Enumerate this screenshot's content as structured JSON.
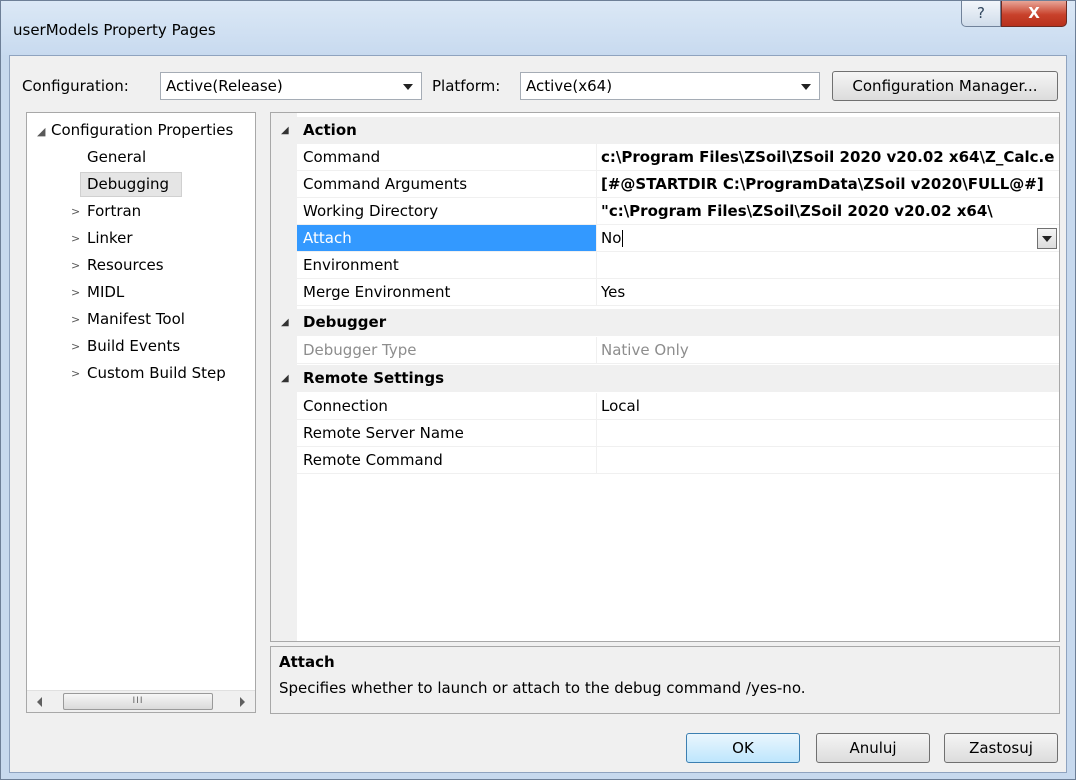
{
  "window": {
    "title": "userModels Property Pages",
    "help_glyph": "?",
    "close_glyph": "X"
  },
  "toolbar": {
    "configuration_label": "Configuration:",
    "configuration_value": "Active(Release)",
    "platform_label": "Platform:",
    "platform_value": "Active(x64)",
    "config_manager_label": "Configuration Manager..."
  },
  "tree": {
    "root": {
      "label": "Configuration Properties",
      "expander": "◢"
    },
    "items": [
      {
        "label": "General",
        "expander": ""
      },
      {
        "label": "Debugging",
        "expander": "",
        "selected": true
      },
      {
        "label": "Fortran",
        "expander": ">"
      },
      {
        "label": "Linker",
        "expander": ">"
      },
      {
        "label": "Resources",
        "expander": ">"
      },
      {
        "label": "MIDL",
        "expander": ">"
      },
      {
        "label": "Manifest Tool",
        "expander": ">"
      },
      {
        "label": "Build Events",
        "expander": ">"
      },
      {
        "label": "Custom Build Step",
        "expander": ">"
      }
    ],
    "scroll_thumb_grip": "III"
  },
  "grid": {
    "categories": [
      {
        "label": "Action",
        "expander": "◢",
        "rows": [
          {
            "name": "Command",
            "value": "c:\\Program Files\\ZSoil\\ZSoil 2020 v20.02 x64\\Z_Calc.e",
            "bold": true
          },
          {
            "name": "Command Arguments",
            "value": "[#@STARTDIR C:\\ProgramData\\ZSoil v2020\\FULL@#]",
            "bold": true
          },
          {
            "name": "Working Directory",
            "value": "\"c:\\Program Files\\ZSoil\\ZSoil 2020 v20.02 x64\\",
            "bold": true
          },
          {
            "name": "Attach",
            "value": "No",
            "selected": true
          },
          {
            "name": "Environment",
            "value": ""
          },
          {
            "name": "Merge Environment",
            "value": "Yes"
          }
        ]
      },
      {
        "label": "Debugger",
        "expander": "◢",
        "rows": [
          {
            "name": "Debugger Type",
            "value": "Native Only",
            "disabled": true
          }
        ]
      },
      {
        "label": "Remote Settings",
        "expander": "◢",
        "rows": [
          {
            "name": "Connection",
            "value": "Local"
          },
          {
            "name": "Remote Server Name",
            "value": ""
          },
          {
            "name": "Remote Command",
            "value": ""
          }
        ]
      }
    ]
  },
  "description": {
    "title": "Attach",
    "text": "Specifies whether to launch or attach to the debug command /yes-no."
  },
  "buttons": {
    "ok": "OK",
    "cancel": "Anuluj",
    "apply": "Zastosuj"
  }
}
